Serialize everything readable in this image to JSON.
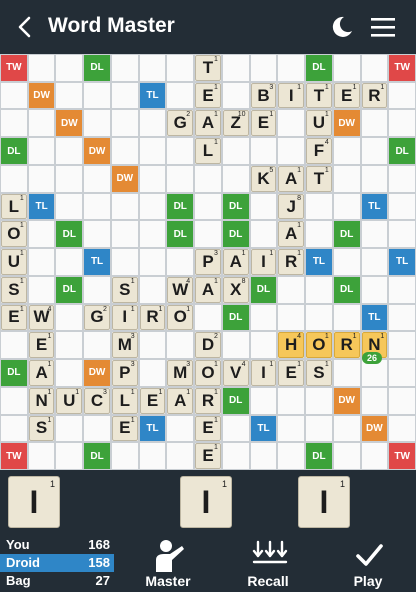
{
  "header": {
    "title": "Word Master"
  },
  "colors": {
    "tw": "#e04848",
    "dw": "#e48a34",
    "tl": "#2f86c7",
    "dl": "#3da23a",
    "tile": "#ece6d4",
    "last_tile": "#f6c75a",
    "bg": "#232d36"
  },
  "board": {
    "size": 15,
    "premiums": [
      [
        "TW",
        0,
        0
      ],
      [
        "DL",
        3,
        0
      ],
      [
        "DL",
        11,
        0
      ],
      [
        "TW",
        14,
        0
      ],
      [
        "DW",
        1,
        1
      ],
      [
        "TL",
        5,
        1
      ],
      [
        "TL",
        9,
        1
      ],
      [
        "DW",
        13,
        1
      ],
      [
        "DW",
        2,
        2
      ],
      [
        "DL",
        6,
        2
      ],
      [
        "DL",
        8,
        2
      ],
      [
        "DW",
        12,
        2
      ],
      [
        "DL",
        0,
        3
      ],
      [
        "DW",
        3,
        3
      ],
      [
        "DL",
        7,
        3
      ],
      [
        "DW",
        11,
        3
      ],
      [
        "DL",
        14,
        3
      ],
      [
        "DW",
        4,
        4
      ],
      [
        "DW",
        10,
        4
      ],
      [
        "TL",
        1,
        5
      ],
      [
        "DL",
        6,
        5
      ],
      [
        "DL",
        8,
        5
      ],
      [
        "TL",
        13,
        5
      ],
      [
        "DL",
        2,
        6
      ],
      [
        "DL",
        6,
        6
      ],
      [
        "DL",
        8,
        6
      ],
      [
        "DL",
        12,
        6
      ],
      [
        "TL",
        3,
        7
      ],
      [
        "DL",
        7,
        7
      ],
      [
        "TL",
        11,
        7
      ],
      [
        "TL",
        14,
        7
      ],
      [
        "DL",
        2,
        8
      ],
      [
        "DL",
        6,
        8
      ],
      [
        "DL",
        9,
        8
      ],
      [
        "DL",
        12,
        8
      ],
      [
        "DL",
        8,
        9
      ],
      [
        "TL",
        13,
        9
      ],
      [
        "DL",
        0,
        11
      ],
      [
        "DW",
        3,
        11
      ],
      [
        "DL",
        8,
        12
      ],
      [
        "DW",
        12,
        12
      ],
      [
        "TL",
        5,
        13
      ],
      [
        "TL",
        9,
        13
      ],
      [
        "DW",
        13,
        13
      ],
      [
        "TW",
        0,
        14
      ],
      [
        "DL",
        3,
        14
      ],
      [
        "DL",
        11,
        14
      ],
      [
        "TW",
        14,
        14
      ]
    ],
    "tiles": [
      [
        "T",
        7,
        0,
        1
      ],
      [
        "E",
        7,
        1,
        1
      ],
      [
        "B",
        9,
        1,
        3
      ],
      [
        "I",
        10,
        1,
        1
      ],
      [
        "T",
        11,
        1,
        1
      ],
      [
        "E",
        12,
        1,
        1
      ],
      [
        "R",
        13,
        1,
        1
      ],
      [
        "G",
        6,
        2,
        2
      ],
      [
        "A",
        7,
        2,
        1
      ],
      [
        "Z",
        8,
        2,
        10
      ],
      [
        "E",
        9,
        2,
        1
      ],
      [
        "U",
        11,
        2,
        1
      ],
      [
        "L",
        7,
        3,
        1
      ],
      [
        "F",
        11,
        3,
        4
      ],
      [
        "K",
        9,
        4,
        5
      ],
      [
        "A",
        10,
        4,
        1
      ],
      [
        "T",
        11,
        4,
        1
      ],
      [
        "L",
        0,
        5,
        1
      ],
      [
        "J",
        10,
        5,
        8
      ],
      [
        "O",
        0,
        6,
        1
      ],
      [
        "A",
        10,
        6,
        1
      ],
      [
        "U",
        0,
        7,
        1
      ],
      [
        "P",
        7,
        7,
        3
      ],
      [
        "A",
        8,
        7,
        1
      ],
      [
        "I",
        9,
        7,
        1
      ],
      [
        "R",
        10,
        7,
        1
      ],
      [
        "S",
        0,
        8,
        1
      ],
      [
        "S",
        4,
        8,
        1
      ],
      [
        "W",
        6,
        8,
        4
      ],
      [
        "A",
        7,
        8,
        1
      ],
      [
        "X",
        8,
        8,
        8
      ],
      [
        "E",
        0,
        9,
        1
      ],
      [
        "W",
        1,
        9,
        4
      ],
      [
        "G",
        3,
        9,
        2
      ],
      [
        "I",
        4,
        9,
        1
      ],
      [
        "R",
        5,
        9,
        1
      ],
      [
        "O",
        6,
        9,
        1
      ],
      [
        "E",
        1,
        10,
        1
      ],
      [
        "M",
        4,
        10,
        3
      ],
      [
        "D",
        7,
        10,
        2
      ],
      [
        "H",
        10,
        10,
        4,
        1
      ],
      [
        "O",
        11,
        10,
        1,
        1
      ],
      [
        "R",
        12,
        10,
        1,
        1
      ],
      [
        "N",
        13,
        10,
        1,
        1
      ],
      [
        "A",
        1,
        11,
        1
      ],
      [
        "P",
        4,
        11,
        3
      ],
      [
        "M",
        6,
        11,
        3
      ],
      [
        "O",
        7,
        11,
        1
      ],
      [
        "V",
        8,
        11,
        4
      ],
      [
        "I",
        9,
        11,
        1
      ],
      [
        "E",
        10,
        11,
        1
      ],
      [
        "S",
        11,
        11,
        1
      ],
      [
        "N",
        1,
        12,
        1
      ],
      [
        "U",
        2,
        12,
        1
      ],
      [
        "C",
        3,
        12,
        3
      ],
      [
        "L",
        4,
        12,
        1
      ],
      [
        "E",
        5,
        12,
        1
      ],
      [
        "A",
        6,
        12,
        1
      ],
      [
        "R",
        7,
        12,
        1
      ],
      [
        "S",
        1,
        13,
        1
      ],
      [
        "E",
        4,
        13,
        1
      ],
      [
        "E",
        7,
        13,
        1
      ],
      [
        "E",
        7,
        14,
        1
      ]
    ],
    "last_move_score": "26"
  },
  "rack": [
    {
      "letter": "I",
      "points": "1"
    },
    {
      "letter": "I",
      "points": "1"
    },
    {
      "letter": "I",
      "points": "1"
    }
  ],
  "scores": [
    {
      "name": "You",
      "value": "168"
    },
    {
      "name": "Droid",
      "value": "158"
    },
    {
      "name": "Bag",
      "value": "27"
    }
  ],
  "buttons": {
    "master": "Master",
    "recall": "Recall",
    "play": "Play"
  }
}
